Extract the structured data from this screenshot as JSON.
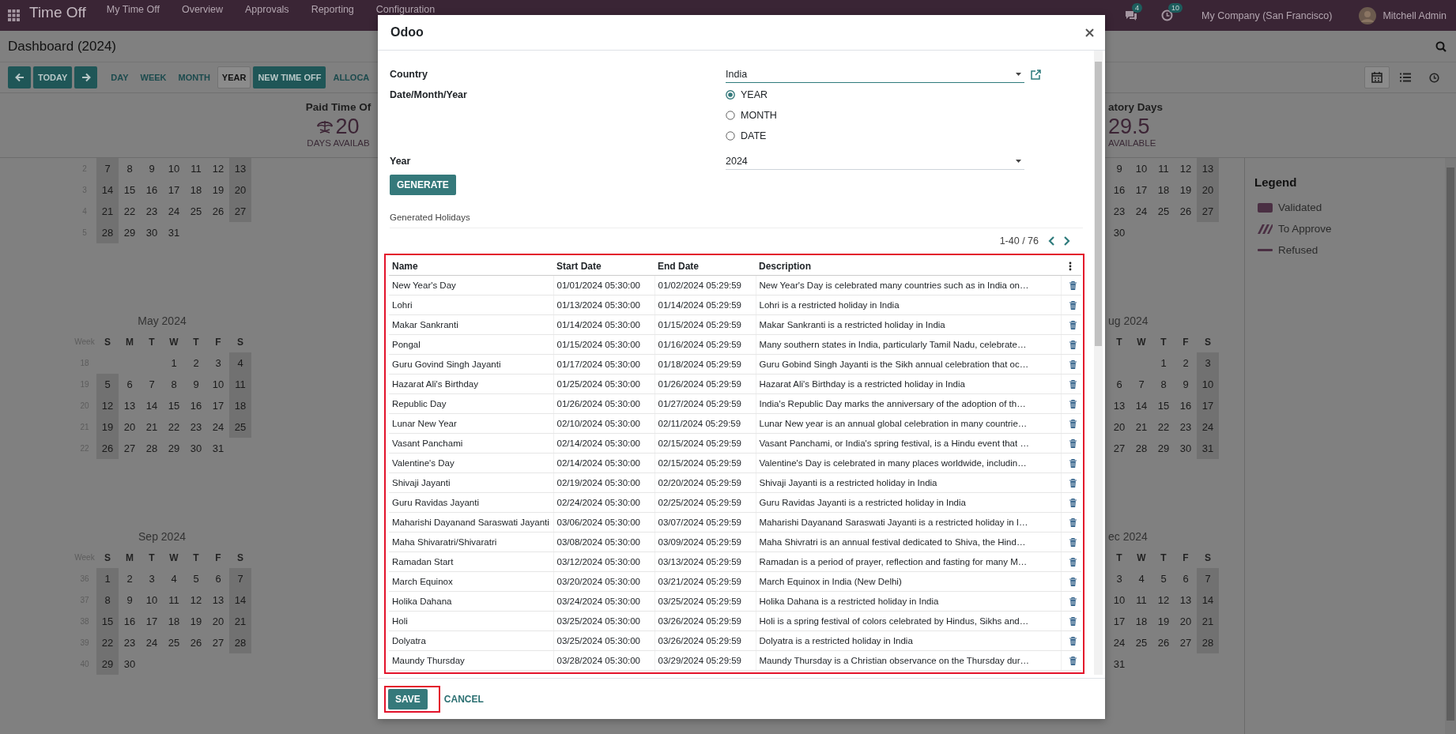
{
  "top_bar": {
    "app_title": "Time Off",
    "menu": [
      "My Time Off",
      "Overview",
      "Approvals",
      "Reporting",
      "Configuration"
    ],
    "messages_count": "4",
    "activities_count": "10",
    "company": "My Company (San Francisco)",
    "user": "Mitchell Admin"
  },
  "control_panel": {
    "title": "Dashboard (2024)",
    "today_button": "TODAY",
    "scales": [
      {
        "label": "DAY",
        "selected": false
      },
      {
        "label": "WEEK",
        "selected": false
      },
      {
        "label": "MONTH",
        "selected": false
      },
      {
        "label": "YEAR",
        "selected": true
      }
    ],
    "new_button": "NEW TIME OFF",
    "allocate_button": "ALLOCA",
    "views": [
      {
        "kind": "calendar",
        "selected": true
      },
      {
        "kind": "list",
        "selected": false
      },
      {
        "kind": "activity",
        "selected": false
      }
    ]
  },
  "summary": [
    {
      "title": "Paid Time Of",
      "kind": "icon",
      "value": "20",
      "caption": "DAYS AVAILAB"
    },
    {
      "title": "atory Days",
      "kind": "plain",
      "value": "29.5",
      "caption": "AVAILABLE"
    }
  ],
  "calendars": {
    "left": [
      {
        "weeks": [
          {
            "number": "2",
            "days": [
              "7",
              "8",
              "9",
              "10",
              "11",
              "12",
              "13"
            ]
          },
          {
            "number": "3",
            "days": [
              "14",
              "15",
              "16",
              "17",
              "18",
              "19",
              "20"
            ]
          },
          {
            "number": "4",
            "days": [
              "21",
              "22",
              "23",
              "24",
              "25",
              "26",
              "27"
            ]
          },
          {
            "number": "5",
            "days": [
              "28",
              "29",
              "30",
              "31"
            ]
          }
        ]
      },
      {
        "title": "May 2024",
        "week_header": "Week",
        "weekdays": [
          "S",
          "M",
          "T",
          "W",
          "T",
          "F",
          "S"
        ],
        "weeks": [
          {
            "number": "18",
            "kind": "first",
            "days": [
              "1",
              "2",
              "3",
              "4"
            ]
          },
          {
            "number": "19",
            "days": [
              "5",
              "6",
              "7",
              "8",
              "9",
              "10",
              "11"
            ]
          },
          {
            "number": "20",
            "days": [
              "12",
              "13",
              "14",
              "15",
              "16",
              "17",
              "18"
            ]
          },
          {
            "number": "21",
            "days": [
              "19",
              "20",
              "21",
              "22",
              "23",
              "24",
              "25"
            ]
          },
          {
            "number": "22",
            "days": [
              "26",
              "27",
              "28",
              "29",
              "30",
              "31"
            ]
          }
        ]
      },
      {
        "title": "Sep 2024",
        "week_header": "Week",
        "weekdays": [
          "S",
          "M",
          "T",
          "W",
          "T",
          "F",
          "S"
        ],
        "weeks": [
          {
            "number": "36",
            "days": [
              "1",
              "2",
              "3",
              "4",
              "5",
              "6",
              "7"
            ]
          },
          {
            "number": "37",
            "days": [
              "8",
              "9",
              "10",
              "11",
              "12",
              "13",
              "14"
            ]
          },
          {
            "number": "38",
            "days": [
              "15",
              "16",
              "17",
              "18",
              "19",
              "20",
              "21"
            ]
          },
          {
            "number": "39",
            "days": [
              "22",
              "23",
              "24",
              "25",
              "26",
              "27",
              "28"
            ]
          },
          {
            "number": "40",
            "days": [
              "29",
              "30"
            ]
          }
        ]
      }
    ],
    "right": [
      {
        "weeks": [
          {
            "days": [
              "9",
              "10",
              "11",
              "12",
              "13"
            ]
          },
          {
            "days": [
              "16",
              "17",
              "18",
              "19",
              "20"
            ]
          },
          {
            "days": [
              "23",
              "24",
              "25",
              "26",
              "27"
            ]
          },
          {
            "days": [
              "30"
            ]
          }
        ]
      },
      {
        "title": "ug 2024",
        "weekdays": [
          "T",
          "W",
          "T",
          "F",
          "S"
        ],
        "weeks": [
          {
            "kind": "first",
            "days": [
              "1",
              "2",
              "3"
            ]
          },
          {
            "days": [
              "6",
              "7",
              "8",
              "9",
              "10"
            ]
          },
          {
            "days": [
              "13",
              "14",
              "15",
              "16",
              "17"
            ]
          },
          {
            "days": [
              "20",
              "21",
              "22",
              "23",
              "24"
            ]
          },
          {
            "days": [
              "27",
              "28",
              "29",
              "30",
              "31"
            ]
          }
        ]
      },
      {
        "title": "ec 2024",
        "weekdays": [
          "T",
          "W",
          "T",
          "F",
          "S"
        ],
        "weeks": [
          {
            "days": [
              "3",
              "4",
              "5",
              "6",
              "7"
            ]
          },
          {
            "days": [
              "10",
              "11",
              "12",
              "13",
              "14"
            ]
          },
          {
            "days": [
              "17",
              "18",
              "19",
              "20",
              "21"
            ]
          },
          {
            "days": [
              "24",
              "25",
              "26",
              "27",
              "28"
            ]
          },
          {
            "days": [
              "31"
            ]
          }
        ]
      }
    ]
  },
  "legend": {
    "title": "Legend",
    "items": [
      {
        "kind": "validated",
        "label": "Validated"
      },
      {
        "kind": "to_approve",
        "label": "To Approve"
      },
      {
        "kind": "refused",
        "label": "Refused"
      }
    ]
  },
  "dialog": {
    "title": "Odoo",
    "country_label": "Country",
    "country": "India",
    "period_label": "Date/Month/Year",
    "period_options": [
      {
        "label": "YEAR",
        "selected": true
      },
      {
        "label": "MONTH",
        "selected": false
      },
      {
        "label": "DATE",
        "selected": false
      }
    ],
    "year_label": "Year",
    "year": "2024",
    "generate_button": "GENERATE",
    "section_title": "Generated Holidays",
    "pager": "1-40 / 76",
    "table": {
      "columns": [
        "Name",
        "Start Date",
        "End Date",
        "Description"
      ],
      "rows": [
        {
          "name": "New Year's Day",
          "start": "01/01/2024 05:30:00",
          "end": "01/02/2024 05:29:59",
          "description": "New Year's Day is celebrated many countries such as in India on…"
        },
        {
          "name": "Lohri",
          "start": "01/13/2024 05:30:00",
          "end": "01/14/2024 05:29:59",
          "description": "Lohri is a restricted holiday in India"
        },
        {
          "name": "Makar Sankranti",
          "start": "01/14/2024 05:30:00",
          "end": "01/15/2024 05:29:59",
          "description": "Makar Sankranti is a restricted holiday in India"
        },
        {
          "name": "Pongal",
          "start": "01/15/2024 05:30:00",
          "end": "01/16/2024 05:29:59",
          "description": "Many southern states in India, particularly Tamil Nadu, celebrate…"
        },
        {
          "name": "Guru Govind Singh Jayanti",
          "start": "01/17/2024 05:30:00",
          "end": "01/18/2024 05:29:59",
          "description": "Guru Gobind Singh Jayanti is the Sikh annual celebration that oc…"
        },
        {
          "name": "Hazarat Ali's Birthday",
          "start": "01/25/2024 05:30:00",
          "end": "01/26/2024 05:29:59",
          "description": "Hazarat Ali's Birthday is a restricted holiday in India"
        },
        {
          "name": "Republic Day",
          "start": "01/26/2024 05:30:00",
          "end": "01/27/2024 05:29:59",
          "description": "India's Republic Day marks the anniversary of the adoption of th…"
        },
        {
          "name": "Lunar New Year",
          "start": "02/10/2024 05:30:00",
          "end": "02/11/2024 05:29:59",
          "description": "Lunar New year is an annual global celebration in many countrie…"
        },
        {
          "name": "Vasant Panchami",
          "start": "02/14/2024 05:30:00",
          "end": "02/15/2024 05:29:59",
          "description": "Vasant Panchami, or India's spring festival, is a Hindu event that …"
        },
        {
          "name": "Valentine's Day",
          "start": "02/14/2024 05:30:00",
          "end": "02/15/2024 05:29:59",
          "description": "Valentine's Day is celebrated in many places worldwide, includin…"
        },
        {
          "name": "Shivaji Jayanti",
          "start": "02/19/2024 05:30:00",
          "end": "02/20/2024 05:29:59",
          "description": "Shivaji Jayanti is a restricted holiday in India"
        },
        {
          "name": "Guru Ravidas Jayanti",
          "start": "02/24/2024 05:30:00",
          "end": "02/25/2024 05:29:59",
          "description": "Guru Ravidas Jayanti is a restricted holiday in India"
        },
        {
          "name": "Maharishi Dayanand Saraswati Jayanti",
          "start": "03/06/2024 05:30:00",
          "end": "03/07/2024 05:29:59",
          "description": "Maharishi Dayanand Saraswati Jayanti is a restricted holiday in I…"
        },
        {
          "name": "Maha Shivaratri/Shivaratri",
          "start": "03/08/2024 05:30:00",
          "end": "03/09/2024 05:29:59",
          "description": "Maha Shivratri is an annual festival dedicated to Shiva, the Hind…"
        },
        {
          "name": "Ramadan Start",
          "start": "03/12/2024 05:30:00",
          "end": "03/13/2024 05:29:59",
          "description": "Ramadan is a period of prayer, reflection and fasting for many M…"
        },
        {
          "name": "March Equinox",
          "start": "03/20/2024 05:30:00",
          "end": "03/21/2024 05:29:59",
          "description": "March Equinox in India (New Delhi)"
        },
        {
          "name": "Holika Dahana",
          "start": "03/24/2024 05:30:00",
          "end": "03/25/2024 05:29:59",
          "description": "Holika Dahana is a restricted holiday in India"
        },
        {
          "name": "Holi",
          "start": "03/25/2024 05:30:00",
          "end": "03/26/2024 05:29:59",
          "description": "Holi is a spring festival of colors celebrated by Hindus, Sikhs and…"
        },
        {
          "name": "Dolyatra",
          "start": "03/25/2024 05:30:00",
          "end": "03/26/2024 05:29:59",
          "description": "Dolyatra is a restricted holiday in India"
        },
        {
          "name": "Maundy Thursday",
          "start": "03/28/2024 05:30:00",
          "end": "03/29/2024 05:29:59",
          "description": "Maundy Thursday is a Christian observance on the Thursday dur…"
        }
      ]
    },
    "save_button": "SAVE",
    "cancel_button": "CANCEL"
  }
}
